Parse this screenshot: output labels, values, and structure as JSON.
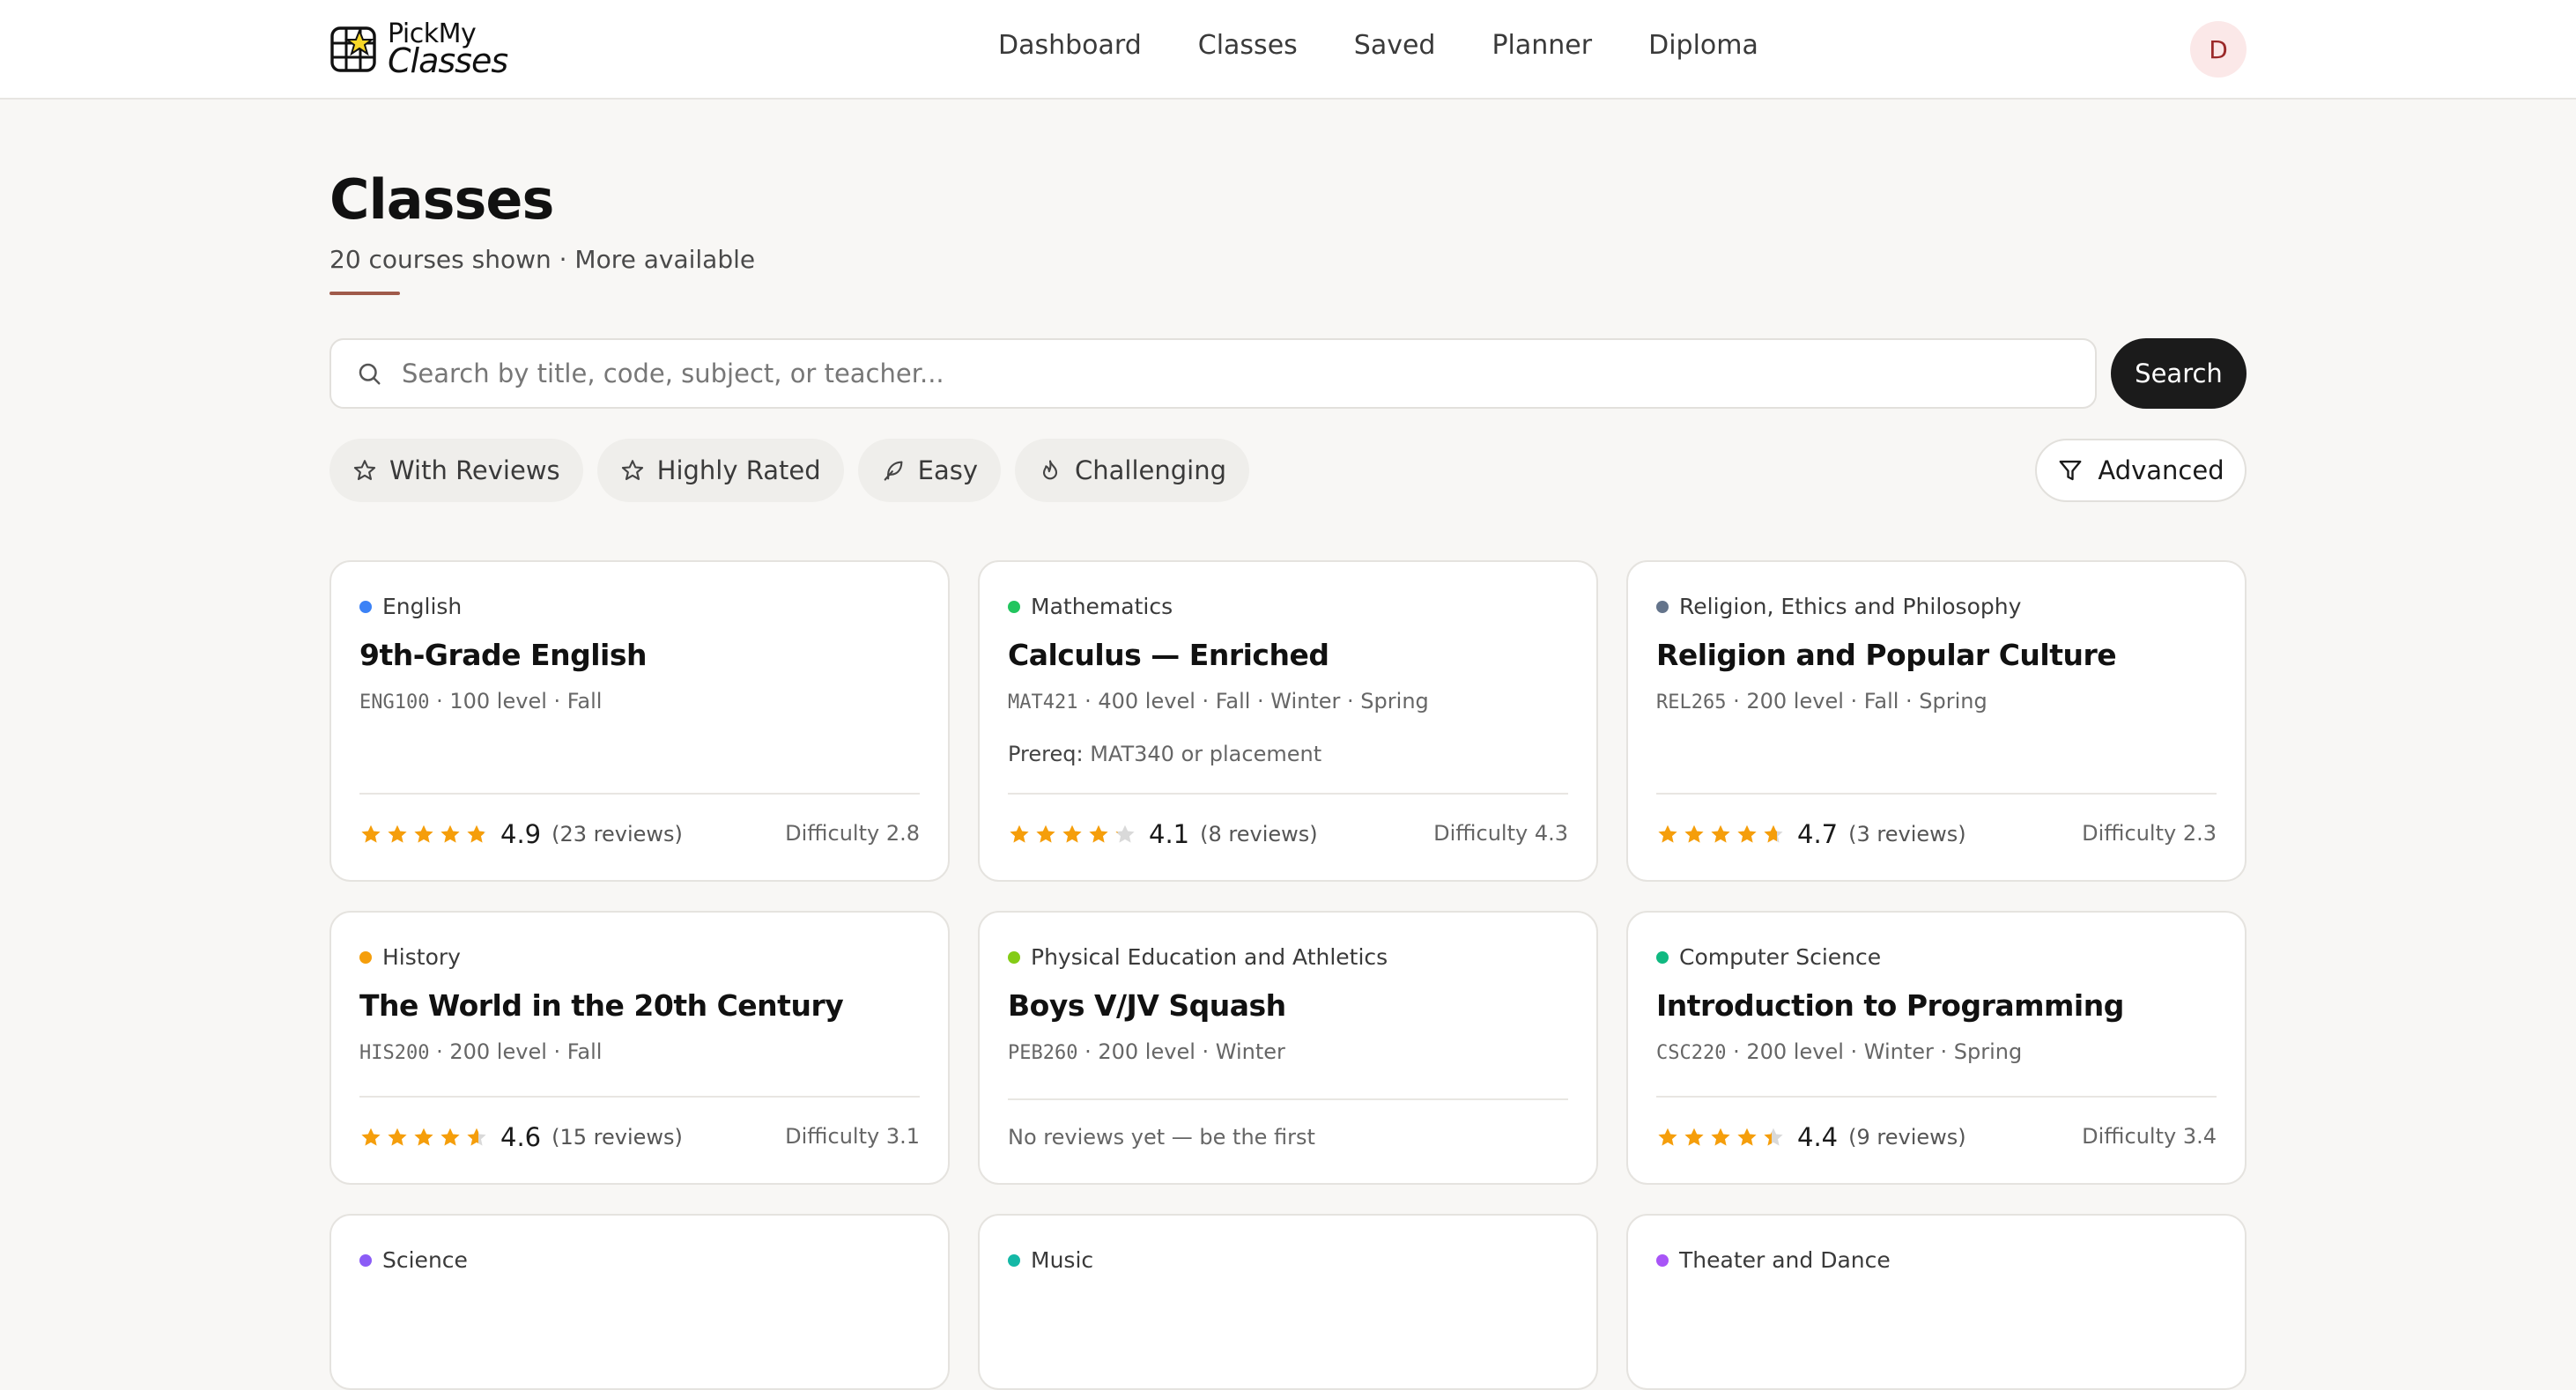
{
  "brand": {
    "top": "PickMy",
    "bottom": "Classes"
  },
  "nav": [
    "Dashboard",
    "Classes",
    "Saved",
    "Planner",
    "Diploma"
  ],
  "user": {
    "initial": "D"
  },
  "header": {
    "title": "Classes",
    "subtitle": "20 courses shown · More available"
  },
  "search": {
    "placeholder": "Search by title, code, subject, or teacher...",
    "button": "Search"
  },
  "filters": [
    {
      "label": "With Reviews",
      "icon": "star-outline-icon"
    },
    {
      "label": "Highly Rated",
      "icon": "star-outline-icon"
    },
    {
      "label": "Easy",
      "icon": "feather-icon"
    },
    {
      "label": "Challenging",
      "icon": "flame-icon"
    }
  ],
  "advanced_label": "Advanced",
  "courses": [
    {
      "subject": "English",
      "color": "#3b82f6",
      "title": "9th-Grade English",
      "code": "ENG100",
      "meta": " · 100 level · Fall",
      "prereq": null,
      "rating": 4.9,
      "rating_text": "4.9",
      "reviews": "(23 reviews)",
      "difficulty": "Difficulty 2.8"
    },
    {
      "subject": "Mathematics",
      "color": "#22c55e",
      "title": "Calculus — Enriched",
      "code": "MAT421",
      "meta": " · 400 level · Fall · Winter · Spring",
      "prereq_label": "Prereq:",
      "prereq": " MAT340 or placement",
      "rating": 4.1,
      "rating_text": "4.1",
      "reviews": "(8 reviews)",
      "difficulty": "Difficulty 4.3"
    },
    {
      "subject": "Religion, Ethics and Philosophy",
      "color": "#64748b",
      "title": "Religion and Popular Culture",
      "code": "REL265",
      "meta": " · 200 level · Fall · Spring",
      "prereq": null,
      "rating": 4.7,
      "rating_text": "4.7",
      "reviews": "(3 reviews)",
      "difficulty": "Difficulty 2.3"
    },
    {
      "subject": "History",
      "color": "#f59e0b",
      "title": "The World in the 20th Century",
      "code": "HIS200",
      "meta": " · 200 level · Fall",
      "prereq": null,
      "rating": 4.6,
      "rating_text": "4.6",
      "reviews": "(15 reviews)",
      "difficulty": "Difficulty 3.1"
    },
    {
      "subject": "Physical Education and Athletics",
      "color": "#84cc16",
      "title": "Boys V/JV Squash",
      "code": "PEB260",
      "meta": " · 200 level · Winter",
      "prereq": null,
      "rating": null,
      "no_reviews": "No reviews yet — be the first"
    },
    {
      "subject": "Computer Science",
      "color": "#10b981",
      "title": "Introduction to Programming",
      "code": "CSC220",
      "meta": " · 200 level · Winter · Spring",
      "prereq": null,
      "rating": 4.4,
      "rating_text": "4.4",
      "reviews": "(9 reviews)",
      "difficulty": "Difficulty 3.4"
    },
    {
      "subject": "Science",
      "color": "#8b5cf6"
    },
    {
      "subject": "Music",
      "color": "#14b8a6"
    },
    {
      "subject": "Theater and Dance",
      "color": "#a855f7"
    }
  ]
}
